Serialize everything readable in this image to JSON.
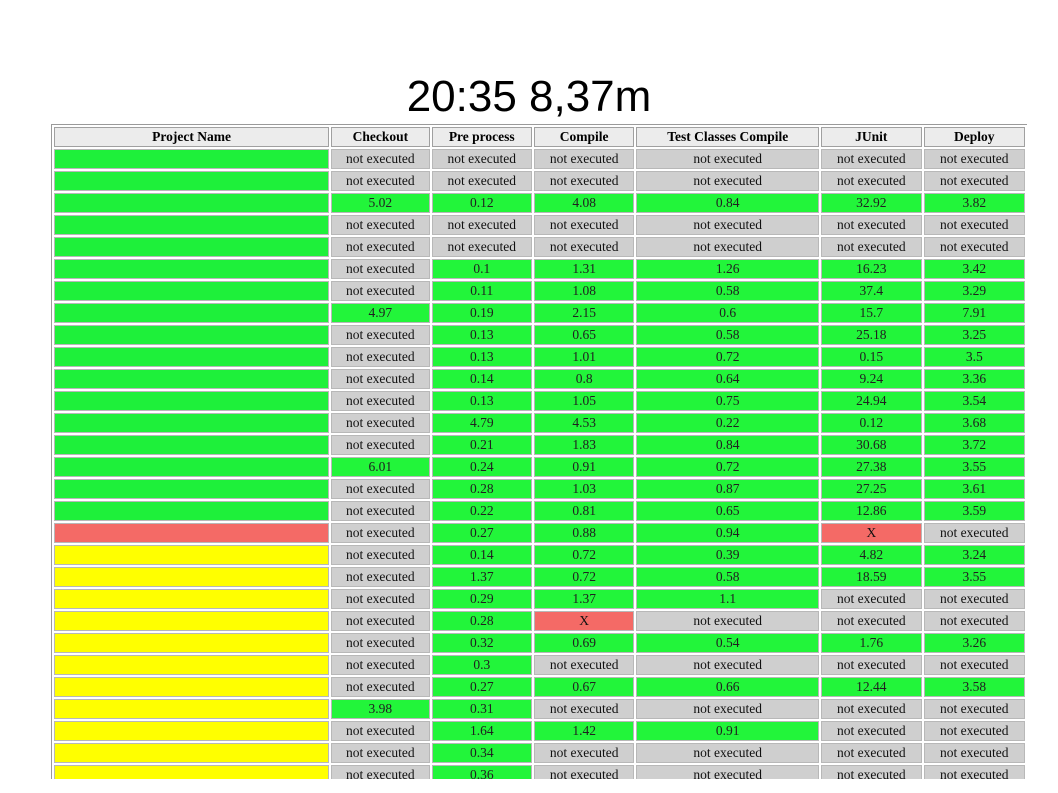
{
  "slide": {
    "title": "20:35 8,37m"
  },
  "table": {
    "headers": [
      "Project Name",
      "Checkout",
      "Pre process",
      "Compile",
      "Test Classes Compile",
      "JUnit",
      "Deploy"
    ],
    "status_colors": {
      "green": "#22f53a",
      "gray": "#cfcfcf",
      "red": "#f46a66",
      "yellow": "#ffff00"
    },
    "rows": [
      {
        "name_status": "green",
        "cells": [
          [
            "not executed",
            "gray"
          ],
          [
            "not executed",
            "gray"
          ],
          [
            "not executed",
            "gray"
          ],
          [
            "not executed",
            "gray"
          ],
          [
            "not executed",
            "gray"
          ],
          [
            "not executed",
            "gray"
          ]
        ]
      },
      {
        "name_status": "green",
        "cells": [
          [
            "not executed",
            "gray"
          ],
          [
            "not executed",
            "gray"
          ],
          [
            "not executed",
            "gray"
          ],
          [
            "not executed",
            "gray"
          ],
          [
            "not executed",
            "gray"
          ],
          [
            "not executed",
            "gray"
          ]
        ]
      },
      {
        "name_status": "green",
        "cells": [
          [
            "5.02",
            "green"
          ],
          [
            "0.12",
            "green"
          ],
          [
            "4.08",
            "green"
          ],
          [
            "0.84",
            "green"
          ],
          [
            "32.92",
            "green"
          ],
          [
            "3.82",
            "green"
          ]
        ]
      },
      {
        "name_status": "green",
        "cells": [
          [
            "not executed",
            "gray"
          ],
          [
            "not executed",
            "gray"
          ],
          [
            "not executed",
            "gray"
          ],
          [
            "not executed",
            "gray"
          ],
          [
            "not executed",
            "gray"
          ],
          [
            "not executed",
            "gray"
          ]
        ]
      },
      {
        "name_status": "green",
        "cells": [
          [
            "not executed",
            "gray"
          ],
          [
            "not executed",
            "gray"
          ],
          [
            "not executed",
            "gray"
          ],
          [
            "not executed",
            "gray"
          ],
          [
            "not executed",
            "gray"
          ],
          [
            "not executed",
            "gray"
          ]
        ]
      },
      {
        "name_status": "green",
        "cells": [
          [
            "not executed",
            "gray"
          ],
          [
            "0.1",
            "green"
          ],
          [
            "1.31",
            "green"
          ],
          [
            "1.26",
            "green"
          ],
          [
            "16.23",
            "green"
          ],
          [
            "3.42",
            "green"
          ]
        ]
      },
      {
        "name_status": "green",
        "cells": [
          [
            "not executed",
            "gray"
          ],
          [
            "0.11",
            "green"
          ],
          [
            "1.08",
            "green"
          ],
          [
            "0.58",
            "green"
          ],
          [
            "37.4",
            "green"
          ],
          [
            "3.29",
            "green"
          ]
        ]
      },
      {
        "name_status": "green",
        "cells": [
          [
            "4.97",
            "green"
          ],
          [
            "0.19",
            "green"
          ],
          [
            "2.15",
            "green"
          ],
          [
            "0.6",
            "green"
          ],
          [
            "15.7",
            "green"
          ],
          [
            "7.91",
            "green"
          ]
        ]
      },
      {
        "name_status": "green",
        "cells": [
          [
            "not executed",
            "gray"
          ],
          [
            "0.13",
            "green"
          ],
          [
            "0.65",
            "green"
          ],
          [
            "0.58",
            "green"
          ],
          [
            "25.18",
            "green"
          ],
          [
            "3.25",
            "green"
          ]
        ]
      },
      {
        "name_status": "green",
        "cells": [
          [
            "not executed",
            "gray"
          ],
          [
            "0.13",
            "green"
          ],
          [
            "1.01",
            "green"
          ],
          [
            "0.72",
            "green"
          ],
          [
            "0.15",
            "green"
          ],
          [
            "3.5",
            "green"
          ]
        ]
      },
      {
        "name_status": "green",
        "cells": [
          [
            "not executed",
            "gray"
          ],
          [
            "0.14",
            "green"
          ],
          [
            "0.8",
            "green"
          ],
          [
            "0.64",
            "green"
          ],
          [
            "9.24",
            "green"
          ],
          [
            "3.36",
            "green"
          ]
        ]
      },
      {
        "name_status": "green",
        "cells": [
          [
            "not executed",
            "gray"
          ],
          [
            "0.13",
            "green"
          ],
          [
            "1.05",
            "green"
          ],
          [
            "0.75",
            "green"
          ],
          [
            "24.94",
            "green"
          ],
          [
            "3.54",
            "green"
          ]
        ]
      },
      {
        "name_status": "green",
        "cells": [
          [
            "not executed",
            "gray"
          ],
          [
            "4.79",
            "green"
          ],
          [
            "4.53",
            "green"
          ],
          [
            "0.22",
            "green"
          ],
          [
            "0.12",
            "green"
          ],
          [
            "3.68",
            "green"
          ]
        ]
      },
      {
        "name_status": "green",
        "cells": [
          [
            "not executed",
            "gray"
          ],
          [
            "0.21",
            "green"
          ],
          [
            "1.83",
            "green"
          ],
          [
            "0.84",
            "green"
          ],
          [
            "30.68",
            "green"
          ],
          [
            "3.72",
            "green"
          ]
        ]
      },
      {
        "name_status": "green",
        "cells": [
          [
            "6.01",
            "green"
          ],
          [
            "0.24",
            "green"
          ],
          [
            "0.91",
            "green"
          ],
          [
            "0.72",
            "green"
          ],
          [
            "27.38",
            "green"
          ],
          [
            "3.55",
            "green"
          ]
        ]
      },
      {
        "name_status": "green",
        "cells": [
          [
            "not executed",
            "gray"
          ],
          [
            "0.28",
            "green"
          ],
          [
            "1.03",
            "green"
          ],
          [
            "0.87",
            "green"
          ],
          [
            "27.25",
            "green"
          ],
          [
            "3.61",
            "green"
          ]
        ]
      },
      {
        "name_status": "green",
        "cells": [
          [
            "not executed",
            "gray"
          ],
          [
            "0.22",
            "green"
          ],
          [
            "0.81",
            "green"
          ],
          [
            "0.65",
            "green"
          ],
          [
            "12.86",
            "green"
          ],
          [
            "3.59",
            "green"
          ]
        ]
      },
      {
        "name_status": "red",
        "cells": [
          [
            "not executed",
            "gray"
          ],
          [
            "0.27",
            "green"
          ],
          [
            "0.88",
            "green"
          ],
          [
            "0.94",
            "green"
          ],
          [
            "X",
            "red"
          ],
          [
            "not executed",
            "gray"
          ]
        ]
      },
      {
        "name_status": "yellow",
        "cells": [
          [
            "not executed",
            "gray"
          ],
          [
            "0.14",
            "green"
          ],
          [
            "0.72",
            "green"
          ],
          [
            "0.39",
            "green"
          ],
          [
            "4.82",
            "green"
          ],
          [
            "3.24",
            "green"
          ]
        ]
      },
      {
        "name_status": "yellow",
        "cells": [
          [
            "not executed",
            "gray"
          ],
          [
            "1.37",
            "green"
          ],
          [
            "0.72",
            "green"
          ],
          [
            "0.58",
            "green"
          ],
          [
            "18.59",
            "green"
          ],
          [
            "3.55",
            "green"
          ]
        ]
      },
      {
        "name_status": "yellow",
        "cells": [
          [
            "not executed",
            "gray"
          ],
          [
            "0.29",
            "green"
          ],
          [
            "1.37",
            "green"
          ],
          [
            "1.1",
            "green"
          ],
          [
            "not executed",
            "gray"
          ],
          [
            "not executed",
            "gray"
          ]
        ]
      },
      {
        "name_status": "yellow",
        "cells": [
          [
            "not executed",
            "gray"
          ],
          [
            "0.28",
            "green"
          ],
          [
            "X",
            "red"
          ],
          [
            "not executed",
            "gray"
          ],
          [
            "not executed",
            "gray"
          ],
          [
            "not executed",
            "gray"
          ]
        ]
      },
      {
        "name_status": "yellow",
        "cells": [
          [
            "not executed",
            "gray"
          ],
          [
            "0.32",
            "green"
          ],
          [
            "0.69",
            "green"
          ],
          [
            "0.54",
            "green"
          ],
          [
            "1.76",
            "green"
          ],
          [
            "3.26",
            "green"
          ]
        ]
      },
      {
        "name_status": "yellow",
        "cells": [
          [
            "not executed",
            "gray"
          ],
          [
            "0.3",
            "green"
          ],
          [
            "not executed",
            "gray"
          ],
          [
            "not executed",
            "gray"
          ],
          [
            "not executed",
            "gray"
          ],
          [
            "not executed",
            "gray"
          ]
        ]
      },
      {
        "name_status": "yellow",
        "cells": [
          [
            "not executed",
            "gray"
          ],
          [
            "0.27",
            "green"
          ],
          [
            "0.67",
            "green"
          ],
          [
            "0.66",
            "green"
          ],
          [
            "12.44",
            "green"
          ],
          [
            "3.58",
            "green"
          ]
        ]
      },
      {
        "name_status": "yellow",
        "cells": [
          [
            "3.98",
            "green"
          ],
          [
            "0.31",
            "green"
          ],
          [
            "not executed",
            "gray"
          ],
          [
            "not executed",
            "gray"
          ],
          [
            "not executed",
            "gray"
          ],
          [
            "not executed",
            "gray"
          ]
        ]
      },
      {
        "name_status": "yellow",
        "cells": [
          [
            "not executed",
            "gray"
          ],
          [
            "1.64",
            "green"
          ],
          [
            "1.42",
            "green"
          ],
          [
            "0.91",
            "green"
          ],
          [
            "not executed",
            "gray"
          ],
          [
            "not executed",
            "gray"
          ]
        ]
      },
      {
        "name_status": "yellow",
        "cells": [
          [
            "not executed",
            "gray"
          ],
          [
            "0.34",
            "green"
          ],
          [
            "not executed",
            "gray"
          ],
          [
            "not executed",
            "gray"
          ],
          [
            "not executed",
            "gray"
          ],
          [
            "not executed",
            "gray"
          ]
        ]
      },
      {
        "name_status": "yellow",
        "cells": [
          [
            "not executed",
            "gray"
          ],
          [
            "0.36",
            "green"
          ],
          [
            "not executed",
            "gray"
          ],
          [
            "not executed",
            "gray"
          ],
          [
            "not executed",
            "gray"
          ],
          [
            "not executed",
            "gray"
          ]
        ]
      }
    ]
  }
}
